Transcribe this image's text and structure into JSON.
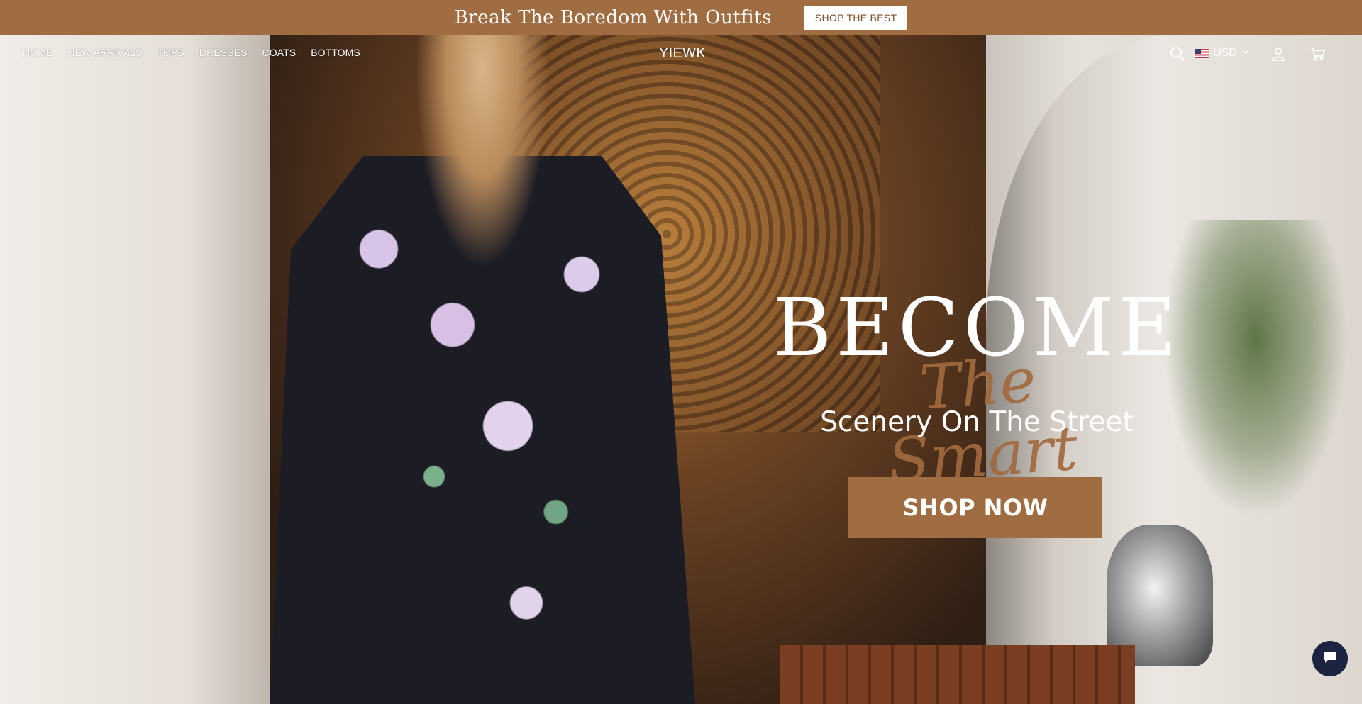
{
  "announcement": {
    "text": "Break The Boredom With Outfits",
    "button_label": "SHOP THE BEST"
  },
  "header": {
    "nav": [
      {
        "label": "HOME"
      },
      {
        "label": "NEW ARRIVALS"
      },
      {
        "label": "TOPS"
      },
      {
        "label": "DRESSES"
      },
      {
        "label": "COATS"
      },
      {
        "label": "BOTTOMS"
      }
    ],
    "logo": "YIEWK",
    "currency": "USD",
    "icons": [
      "search-icon",
      "us-flag-icon",
      "chevron-down-icon",
      "account-icon",
      "cart-icon"
    ]
  },
  "hero": {
    "headline": "BECOME",
    "script_text": "The Smart",
    "subheadline": "Scenery On The Street",
    "cta_label": "SHOP NOW"
  },
  "chat": {
    "icon": "chat-icon"
  },
  "colors": {
    "brand": "#a06c42",
    "chat": "#1c2341",
    "text_light": "#ffffff"
  }
}
